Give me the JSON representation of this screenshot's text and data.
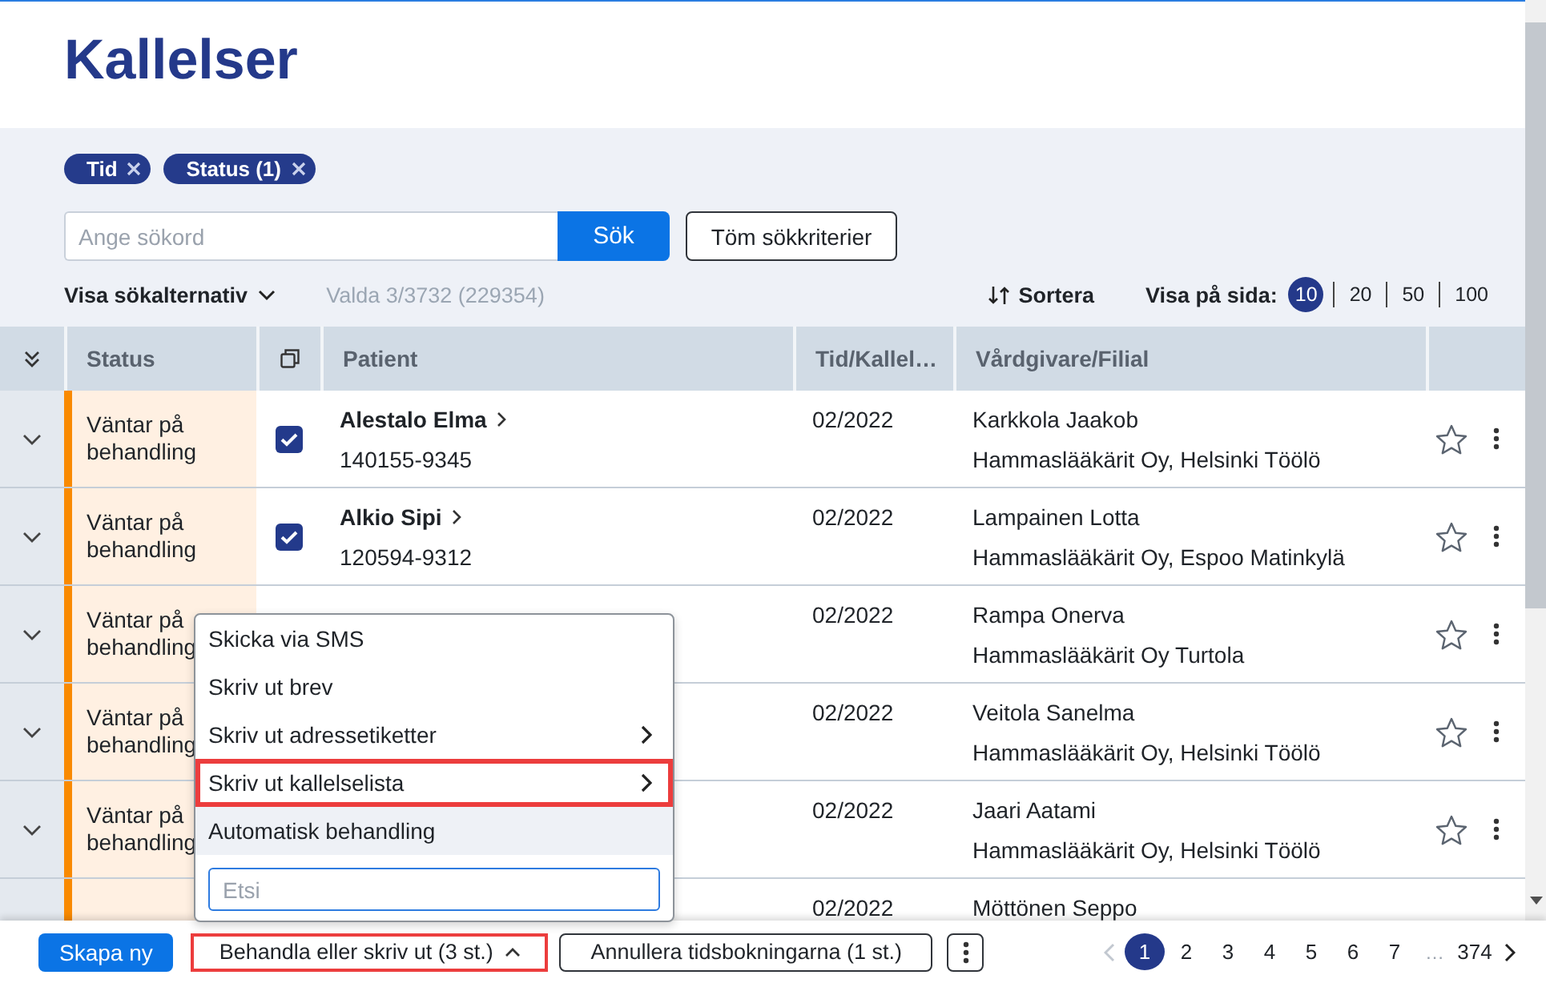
{
  "header": {
    "title": "Kallelser"
  },
  "filters": {
    "chips": [
      {
        "label": "Tid"
      },
      {
        "label": "Status (1)"
      }
    ],
    "search": {
      "placeholder": "Ange sökord",
      "button": "Sök"
    },
    "clear_button": "Töm sökkriterier",
    "options_toggle": {
      "label": "Visa sökalternativ",
      "expanded": false
    },
    "selection_info": "Valda 3/3732 (229354)",
    "sort_button": "Sortera",
    "page_size": {
      "label": "Visa på sida:",
      "options": [
        {
          "label": "10",
          "selected": true
        },
        {
          "label": "20",
          "selected": false
        },
        {
          "label": "50",
          "selected": false
        },
        {
          "label": "100",
          "selected": false
        }
      ]
    }
  },
  "table": {
    "columns": [
      "Status",
      "Patient",
      "Tid/Kallel…",
      "Vårdgivare/Filial"
    ],
    "rows": [
      {
        "status": "Väntar på behandling",
        "checked": true,
        "patient_name": "Alestalo Elma",
        "patient_id": "140155-9345",
        "time": "02/2022",
        "caregiver": "Karkkola Jaakob",
        "clinic": "Hammaslääkärit Oy, Helsinki Töölö",
        "favorite": false
      },
      {
        "status": "Väntar på behandling",
        "checked": true,
        "patient_name": "Alkio Sipi",
        "patient_id": "120594-9312",
        "time": "02/2022",
        "caregiver": "Lampainen Lotta",
        "clinic": "Hammaslääkärit Oy, Espoo Matinkylä",
        "favorite": false
      },
      {
        "status": "Väntar på behandling",
        "time": "02/2022",
        "caregiver": "Rampa Onerva",
        "clinic": "Hammaslääkärit Oy Turtola",
        "favorite": false
      },
      {
        "status": "Väntar på behandling",
        "time": "02/2022",
        "caregiver": "Veitola Sanelma",
        "clinic": "Hammaslääkärit Oy, Helsinki Töölö",
        "favorite": false
      },
      {
        "status": "Väntar på behandling",
        "time": "02/2022",
        "caregiver": "Jaari Aatami",
        "clinic": "Hammaslääkärit Oy, Helsinki Töölö",
        "favorite": false
      },
      {
        "time": "02/2022",
        "caregiver": "Möttönen Seppo"
      }
    ]
  },
  "menu": {
    "items": [
      {
        "label": "Skicka via SMS",
        "submenu": false,
        "hovered": false,
        "annotated": false
      },
      {
        "label": "Skriv ut brev",
        "submenu": false,
        "hovered": false,
        "annotated": false
      },
      {
        "label": "Skriv ut adressetiketter",
        "submenu": true,
        "hovered": false,
        "annotated": false
      },
      {
        "label": "Skriv ut kallelselista",
        "submenu": true,
        "hovered": false,
        "annotated": true
      },
      {
        "label": "Automatisk behandling",
        "submenu": false,
        "hovered": true,
        "annotated": false
      }
    ],
    "search": {
      "placeholder": "Etsi"
    }
  },
  "footer": {
    "create_button": "Skapa ny",
    "process_button": {
      "label": "Behandla eller skriv ut (3 st.)",
      "expanded": true,
      "annotated": true
    },
    "cancel_button": "Annullera tidsbokningarna (1 st.)",
    "pagination": {
      "previous": {
        "disabled": true
      },
      "next": {
        "disabled": false
      },
      "pages": [
        {
          "kind": "page",
          "label": "1",
          "selected": true
        },
        {
          "kind": "page",
          "label": "2",
          "selected": false
        },
        {
          "kind": "page",
          "label": "3",
          "selected": false
        },
        {
          "kind": "page",
          "label": "4",
          "selected": false
        },
        {
          "kind": "page",
          "label": "5",
          "selected": false
        },
        {
          "kind": "page",
          "label": "6",
          "selected": false
        },
        {
          "kind": "page",
          "label": "7",
          "selected": false
        },
        {
          "kind": "gap",
          "label": "…"
        },
        {
          "kind": "page",
          "label": "374",
          "selected": false
        }
      ]
    }
  }
}
